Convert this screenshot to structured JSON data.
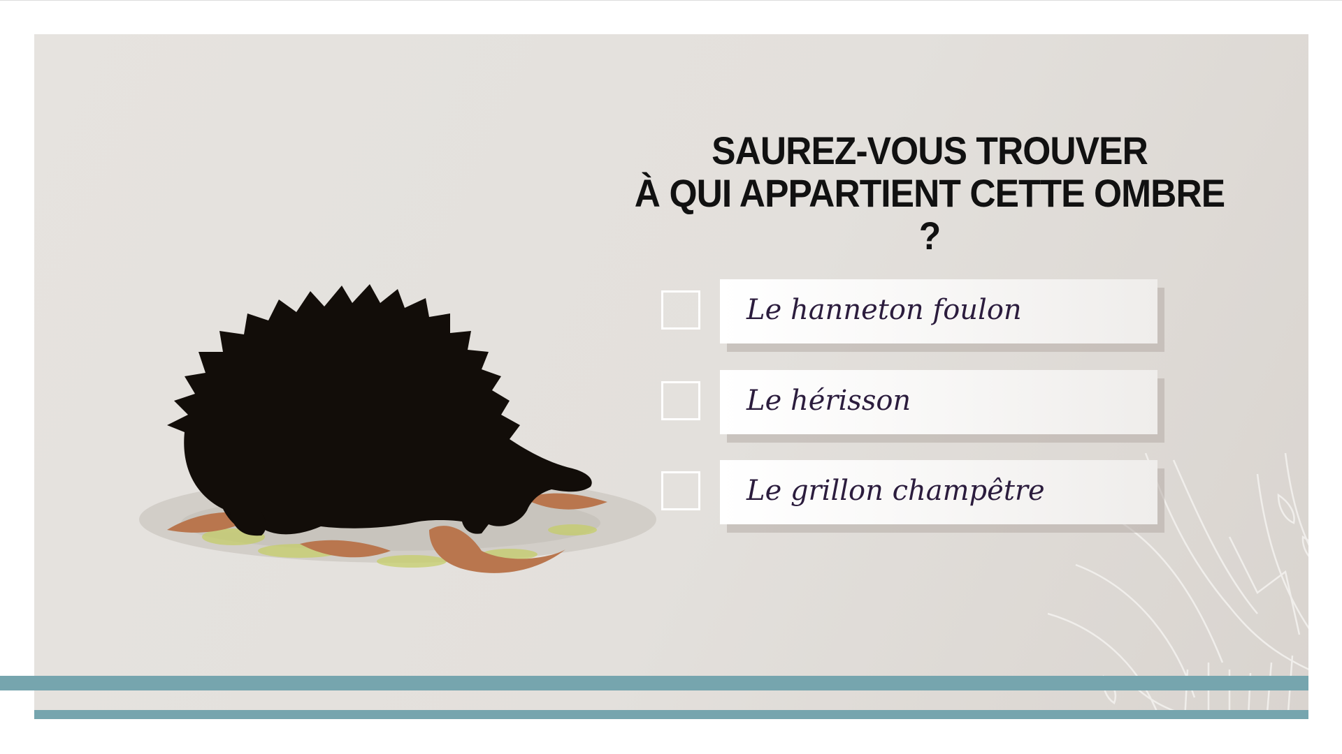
{
  "quiz": {
    "question_line1": "SAUREZ-VOUS TROUVER",
    "question_line2": "À QUI APPARTIENT CETTE OMBRE ?",
    "options": [
      {
        "label": "Le hanneton foulon",
        "checked": false
      },
      {
        "label": "Le hérisson",
        "checked": false
      },
      {
        "label": "Le grillon champêtre",
        "checked": false
      }
    ]
  },
  "illustration": {
    "subject": "hedgehog-silhouette-icon"
  },
  "colors": {
    "background": "#e4e1dd",
    "accent_bar": "#76a5ae",
    "silhouette": "#120d09",
    "text_dark": "#111111",
    "answer_text": "#2b1c3d",
    "leaf": "#b9764e",
    "moss": "#c5cd6a"
  }
}
